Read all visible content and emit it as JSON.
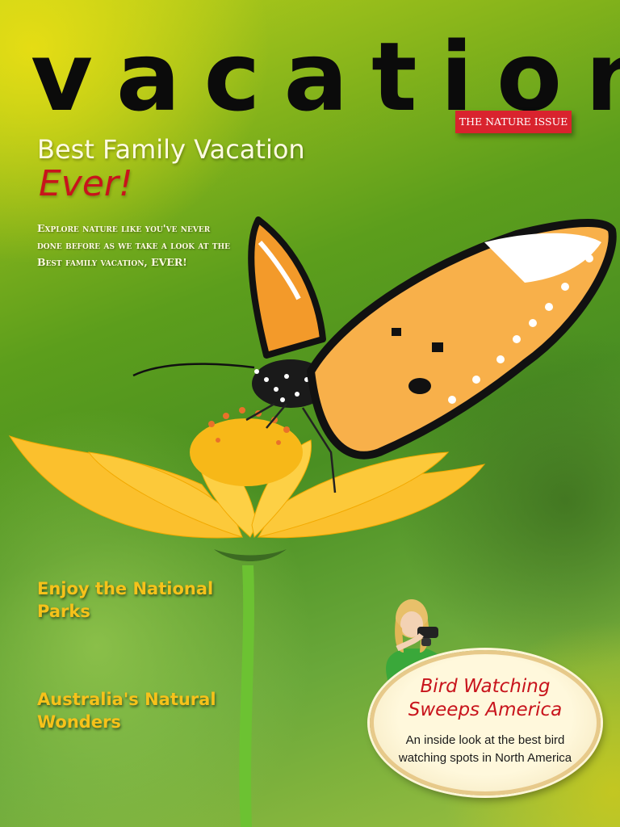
{
  "masthead": {
    "title": "vacation"
  },
  "issue_tag": {
    "label": "The Nature Issue"
  },
  "cover_story": {
    "headline_line1": "Best Family Vacation",
    "headline_line2": "Ever!",
    "blurb": "Explore nature like you've never done before as we take a look at the Best family vacation, EVER!"
  },
  "side_stories": [
    {
      "title": "Enjoy the National Parks"
    },
    {
      "title": "Australia's Natural Wonders"
    }
  ],
  "feature_badge": {
    "title": "Bird Watching Sweeps America",
    "text": "An inside look at the best bird watching spots in North America"
  },
  "colors": {
    "masthead": "#0b0b0b",
    "accent_red": "#c8141c",
    "tag_red": "#d9232e",
    "side_yellow": "#f6c21a",
    "background_green": "#4a8f22"
  }
}
